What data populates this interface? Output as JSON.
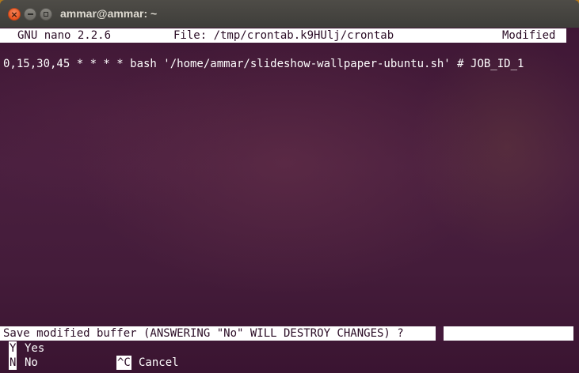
{
  "window": {
    "title": "ammar@ammar: ~",
    "buttons": {
      "close_glyph": "×"
    }
  },
  "nano": {
    "header": {
      "version": "GNU nano 2.2.6",
      "file": "File: /tmp/crontab.k9HUlj/crontab",
      "status": "Modified"
    },
    "buffer_lines": [
      "0,15,30,45 * * * * bash '/home/ammar/slideshow-wallpaper-ubuntu.sh' # JOB_ID_1"
    ],
    "prompt": "Save modified buffer (ANSWERING \"No\" WILL DESTROY CHANGES) ?",
    "options": [
      {
        "key": "Y",
        "label": "Yes"
      },
      {
        "key": "N",
        "label": "No"
      },
      {
        "key": "^C",
        "label": "Cancel"
      }
    ]
  },
  "colors": {
    "terminal_bg": "#4a1f3f",
    "titlebar": "#3e3d39",
    "close_button": "#e9541f",
    "inverse_fg": "#2b0d26"
  }
}
